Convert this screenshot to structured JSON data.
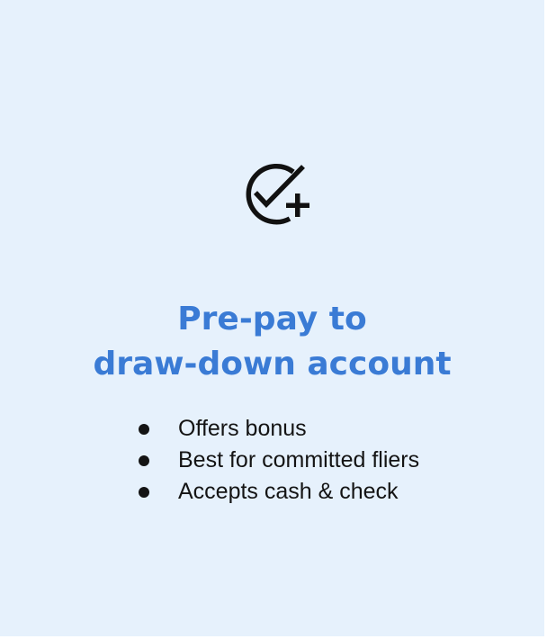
{
  "card": {
    "background": "#e6f1fc",
    "icon": "check-circle-plus-icon",
    "title_line1": "Pre-pay to",
    "title_line2": "draw-down account",
    "title_color": "#3a7bd5",
    "bullets": [
      "Offers bonus",
      "Best for committed fliers",
      "Accepts cash & check"
    ]
  }
}
